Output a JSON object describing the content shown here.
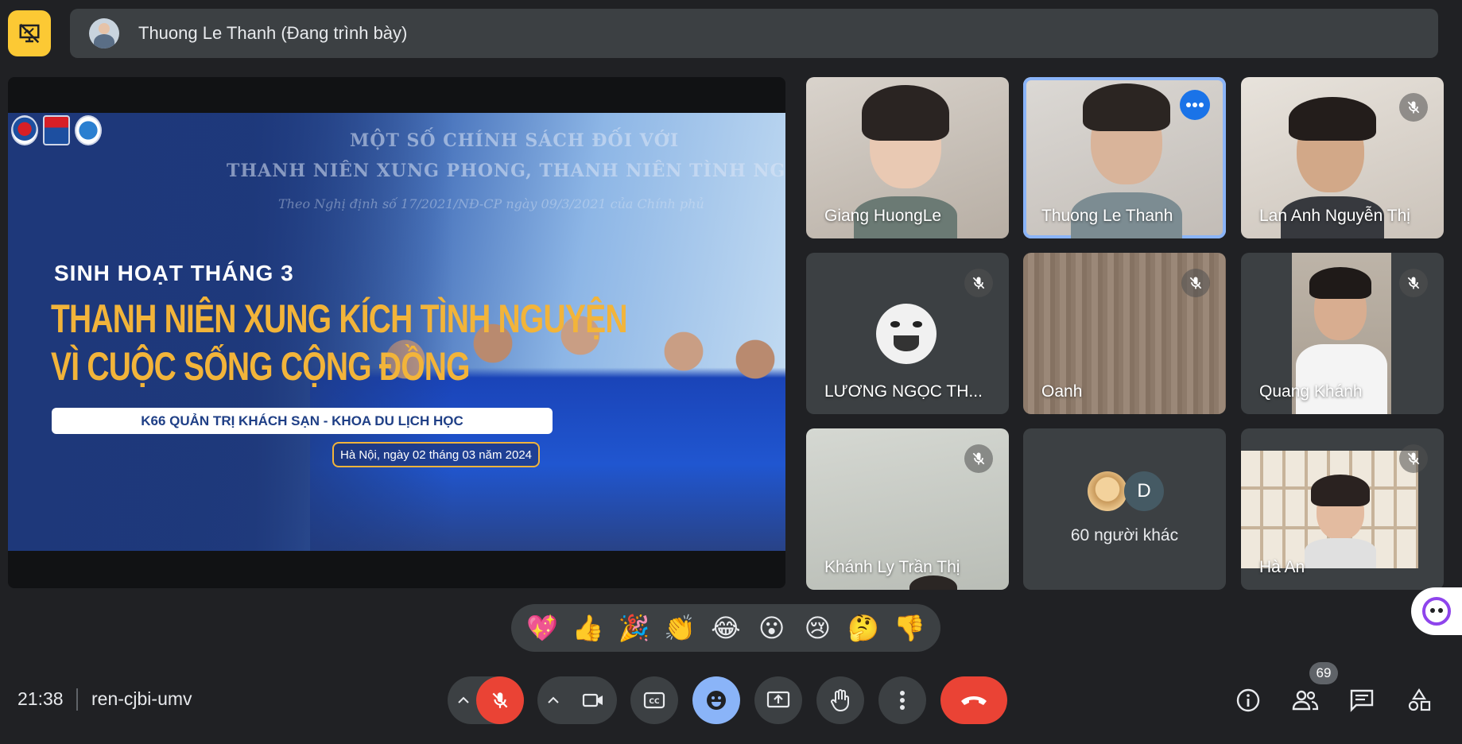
{
  "top_bar": {
    "presenter_name": "Thuong Le Thanh (Đang trình bày)"
  },
  "slide": {
    "heading_line1": "MỘT SỐ CHÍNH SÁCH ĐỐI VỚI",
    "heading_line2": "THANH NIÊN XUNG PHONG, THANH NIÊN TÌNH NGUYỆN",
    "heading_line3": "Theo Nghị định số 17/2021/NĐ-CP ngày 09/3/2021 của Chính phủ",
    "subtitle": "SINH HOẠT THÁNG 3",
    "title_line1": "THANH NIÊN XUNG KÍCH TÌNH NGUYỆN",
    "title_line2": "VÌ CUỘC SỐNG CỘNG ĐỒNG",
    "band_text": "K66 QUẢN TRỊ KHÁCH SẠN - KHOA DU LỊCH HỌC",
    "date_text": "Hà Nội, ngày 02 tháng 03 năm 2024"
  },
  "participants": [
    {
      "name": "Giang HuongLe",
      "muted": false
    },
    {
      "name": "Thuong Le Thanh",
      "muted": false,
      "active": true
    },
    {
      "name": "Lan Anh Nguyễn Thị",
      "muted": true
    },
    {
      "name": "LƯƠNG NGỌC TH...",
      "muted": true
    },
    {
      "name": "Oanh",
      "muted": true
    },
    {
      "name": "Quang Khánh",
      "muted": true
    },
    {
      "name": "Khánh Ly Trần Thị",
      "muted": true
    },
    {
      "name": "Hà An",
      "muted": true
    }
  ],
  "others_tile": {
    "avatar_letter": "D",
    "label": "60 người khác"
  },
  "reactions": [
    "💖",
    "👍",
    "🎉",
    "👏",
    "😂",
    "😮",
    "😢",
    "🤔",
    "👎"
  ],
  "bottom_bar": {
    "time": "21:38",
    "meeting_code": "ren-cjbi-umv",
    "participant_count": "69"
  },
  "colors": {
    "background": "#202124",
    "surface": "#3c4043",
    "accent_yellow": "#fcc934",
    "danger_red": "#ea4335",
    "active_blue": "#8ab4f8"
  }
}
